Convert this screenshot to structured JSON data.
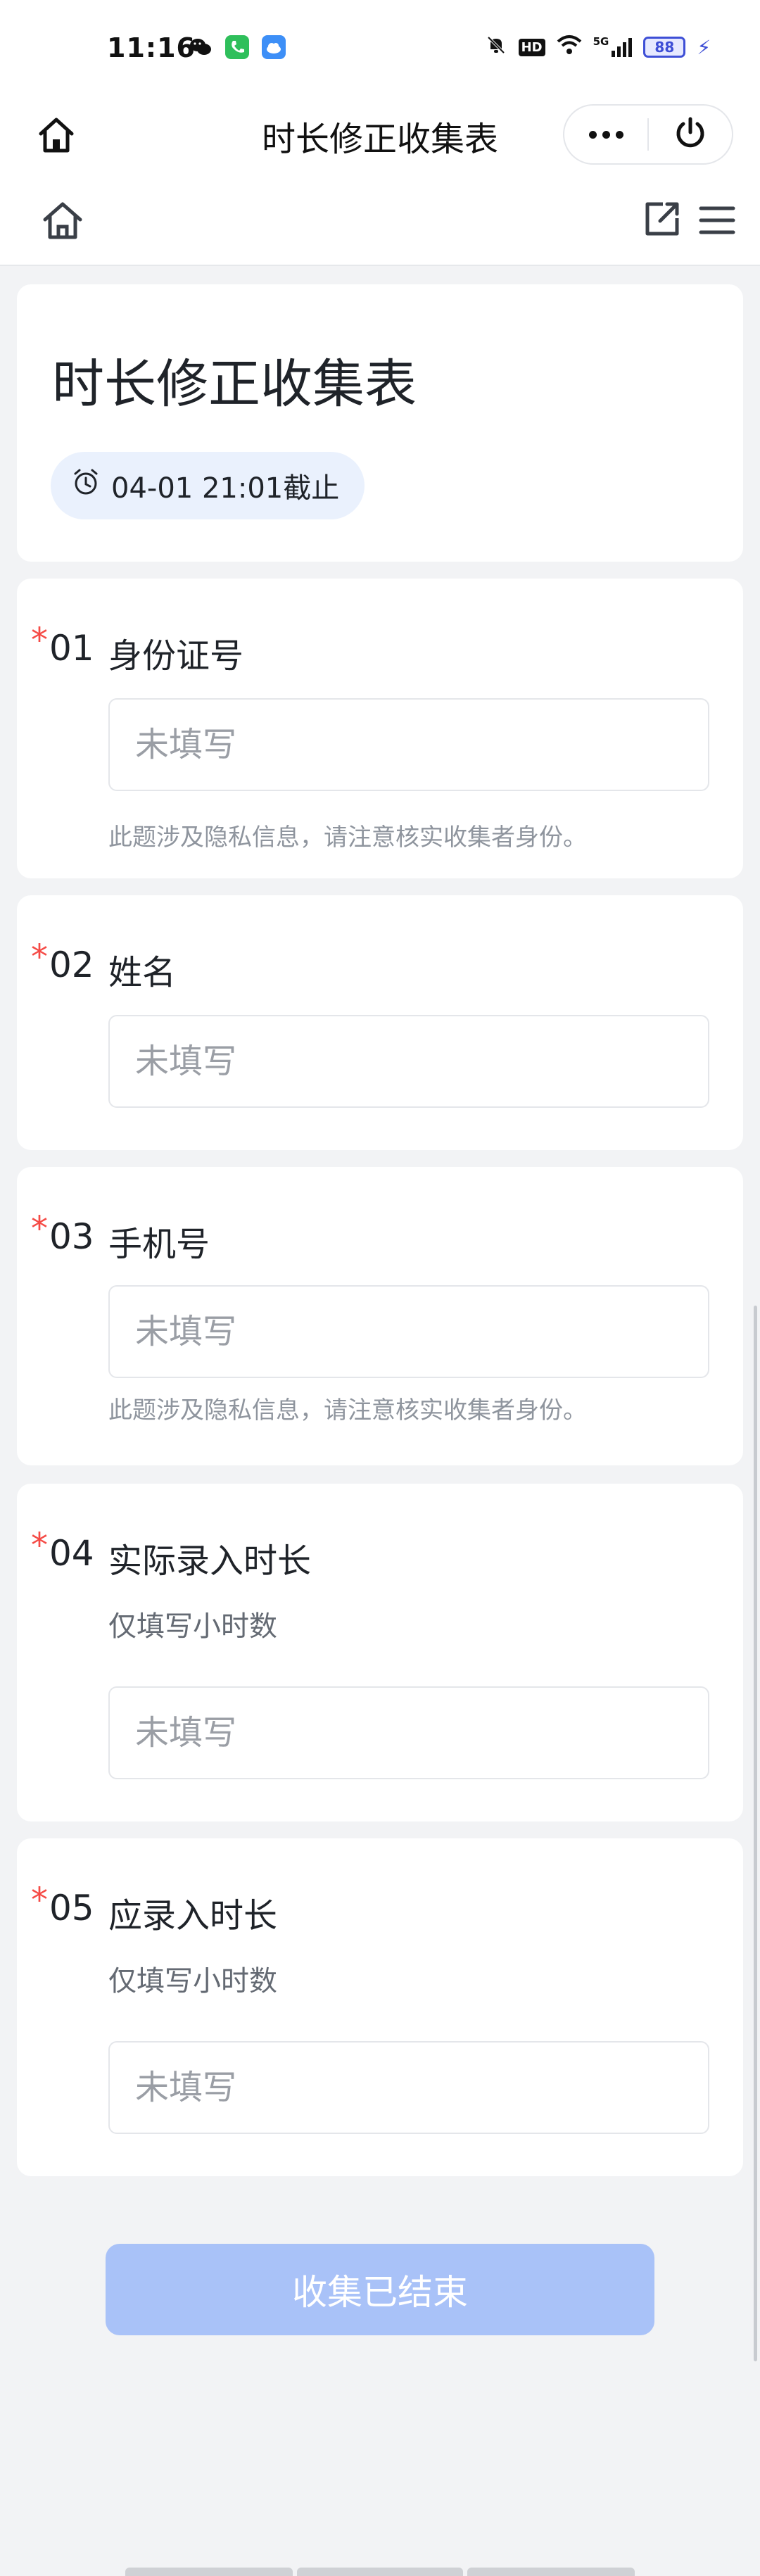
{
  "status_bar": {
    "time": "11:16",
    "network": "5G",
    "battery": "88",
    "icons": [
      "wechat-icon",
      "phone-app-icon",
      "cloud-app-icon",
      "mute-icon",
      "hd-icon",
      "wifi-icon",
      "signal-icon",
      "battery-icon",
      "charging-icon"
    ],
    "hd_label": "HD"
  },
  "nav": {
    "title": "时长修正收集表",
    "icons": [
      "home-icon",
      "more-icon",
      "power-icon"
    ]
  },
  "toolbar": {
    "icons": [
      "home-icon",
      "share-icon",
      "menu-icon"
    ]
  },
  "form": {
    "title": "时长修正收集表",
    "deadline": "04-01 21:01截止",
    "deadline_icon": "alarm-clock-icon"
  },
  "questions": [
    {
      "required": "*",
      "num": "01",
      "label": "身份证号",
      "placeholder": "未填写",
      "note": "此题涉及隐私信息，请注意核实收集者身份。"
    },
    {
      "required": "*",
      "num": "02",
      "label": "姓名",
      "placeholder": "未填写"
    },
    {
      "required": "*",
      "num": "03",
      "label": "手机号",
      "placeholder": "未填写",
      "note": "此题涉及隐私信息，请注意核实收集者身份。"
    },
    {
      "required": "*",
      "num": "04",
      "label": "实际录入时长",
      "hint": "仅填写小时数",
      "placeholder": "未填写"
    },
    {
      "required": "*",
      "num": "05",
      "label": "应录入时长",
      "hint": "仅填写小时数",
      "placeholder": "未填写"
    }
  ],
  "submit_label": "收集已结束",
  "colors": {
    "required": "#f54a45",
    "submit_disabled": "#a9c2f8",
    "deadline_bg": "#eaf1fd",
    "page_bg": "#f2f3f5"
  }
}
